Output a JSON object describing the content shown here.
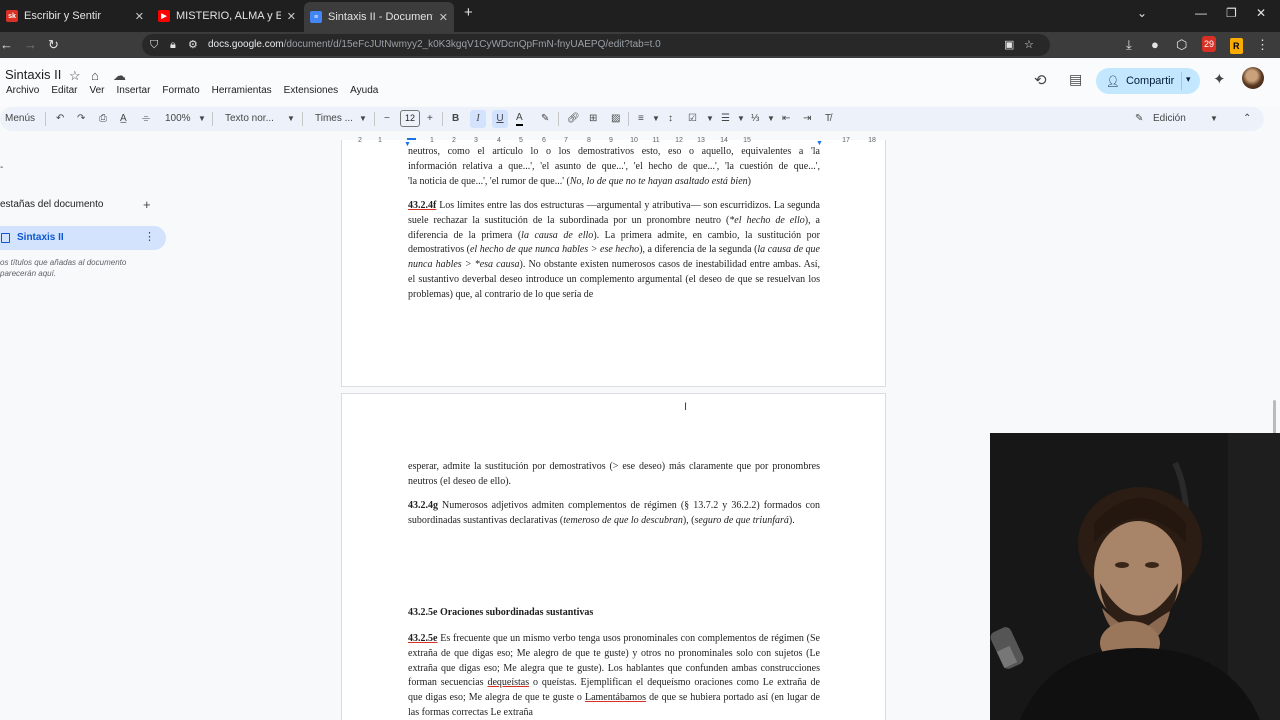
{
  "browser": {
    "tabs": [
      {
        "title": "Escribir y Sentir",
        "favicon_text": "sk",
        "favicon_color": "#d93025"
      },
      {
        "title": "MISTERIO, ALMA y EL SENTIDO",
        "favicon_text": "▶",
        "favicon_color": "#ff0000"
      },
      {
        "title": "Sintaxis II - Documentos de Go",
        "favicon_text": "≡",
        "favicon_color": "#4285f4",
        "active": true
      }
    ],
    "url_domain": "docs.google.com",
    "url_path": "/document/d/15eFcJUtNwmyy2_k0K3kgqV1CyWDcnQpFmN-fnyUAEPQ/edit?tab=t.0",
    "extension_badge": "29"
  },
  "doc": {
    "title": "Sintaxis II",
    "menus": [
      "Archivo",
      "Editar",
      "Ver",
      "Insertar",
      "Formato",
      "Herramientas",
      "Extensiones",
      "Ayuda"
    ],
    "share_label": "Compartir",
    "mode_label": "Edición"
  },
  "toolbar": {
    "menus_label": "Menús",
    "zoom": "100%",
    "style": "Texto nor...",
    "font": "Times ...",
    "font_size": "12"
  },
  "sidebar": {
    "title": "estañas del documento",
    "item": "Sintaxis II",
    "hint_line1": "os títulos que añadas al documento",
    "hint_line2": "parecerán aquí."
  },
  "ruler": [
    "2",
    "1",
    "1",
    "2",
    "3",
    "4",
    "5",
    "6",
    "7",
    "8",
    "9",
    "10",
    "11",
    "12",
    "13",
    "14",
    "15",
    "16",
    "17",
    "18"
  ],
  "page1": {
    "para0_line1": "neutros, como el artículo lo o los demostrativos esto, eso o aquello, equivalentes a 'la",
    "para0_line2": "información relativa a que...', 'el asunto de que...', 'el hecho de que...', 'la cuestión de que...',",
    "para0_line3a": "'la noticia de que...', 'el rumor de que...' (",
    "para0_line3b": "No, lo de que no te hayan asaltado está bien",
    "para0_line3c": ")",
    "p43_2_4f_label": "43.2.4f",
    "p43_2_4f_a": " Los límites entre las dos estructuras —argumental y atributiva— son escurridizos. La segunda suele rechazar la sustitución de la subordinada por un pronombre neutro (",
    "p43_2_4f_b": "*el hecho de ello",
    "p43_2_4f_c": "), a diferencia de la primera (",
    "p43_2_4f_d": "la causa de ello",
    "p43_2_4f_e": "). La primera admite, en cambio, la sustitución por demostrativos (",
    "p43_2_4f_f": "el hecho de que nunca hables > ese hecho",
    "p43_2_4f_g": "), a diferencia de la segunda (",
    "p43_2_4f_h": "la causa de que nunca hables > *esa causa",
    "p43_2_4f_i": "). No obstante existen numerosos casos de inestabilidad entre ambas. Así, el sustantivo deverbal deseo introduce un complemento argumental (el deseo de que se resuelvan los problemas) que, al contrario de lo que sería de"
  },
  "page2": {
    "cont": "esperar, admite la sustitución por demostrativos (> ese deseo) más claramente que por pronombres neutros (el deseo de ello).",
    "p43_2_4g_label": "43.2.4g",
    "p43_2_4g_a": " Numerosos adjetivos admiten complementos de régimen (§ 13.7.2 y 36.2.2) formados con subordinadas sustantivas declarativas (",
    "p43_2_4g_b": "temeroso de que lo descubran",
    "p43_2_4g_c": "), (",
    "p43_2_4g_d": "seguro de que triunfará",
    "p43_2_4g_e": ").",
    "heading": "43.2.5e Oraciones subordinadas sustantivas",
    "p43_2_5e_label": "43.2.5e",
    "p43_2_5e_a": " Es frecuente que un mismo verbo tenga usos pronominales con complementos de régimen (Se extraña de que digas eso; Me alegro de que te guste) y otros no pronominales solo con sujetos (Le extraña que digas eso; Me alegra que te guste). Los hablantes que confunden ambas construcciones forman secuencias ",
    "p43_2_5e_b": "dequeístas",
    "p43_2_5e_c": " o queístas. Ejemplifican el dequeísmo oraciones como Le extraña de que digas eso; Me alegra de que te guste o ",
    "p43_2_5e_d": "Lamentábamos",
    "p43_2_5e_e": " de que se hubiera portado así (en lugar de las formas correctas Le extraña"
  }
}
